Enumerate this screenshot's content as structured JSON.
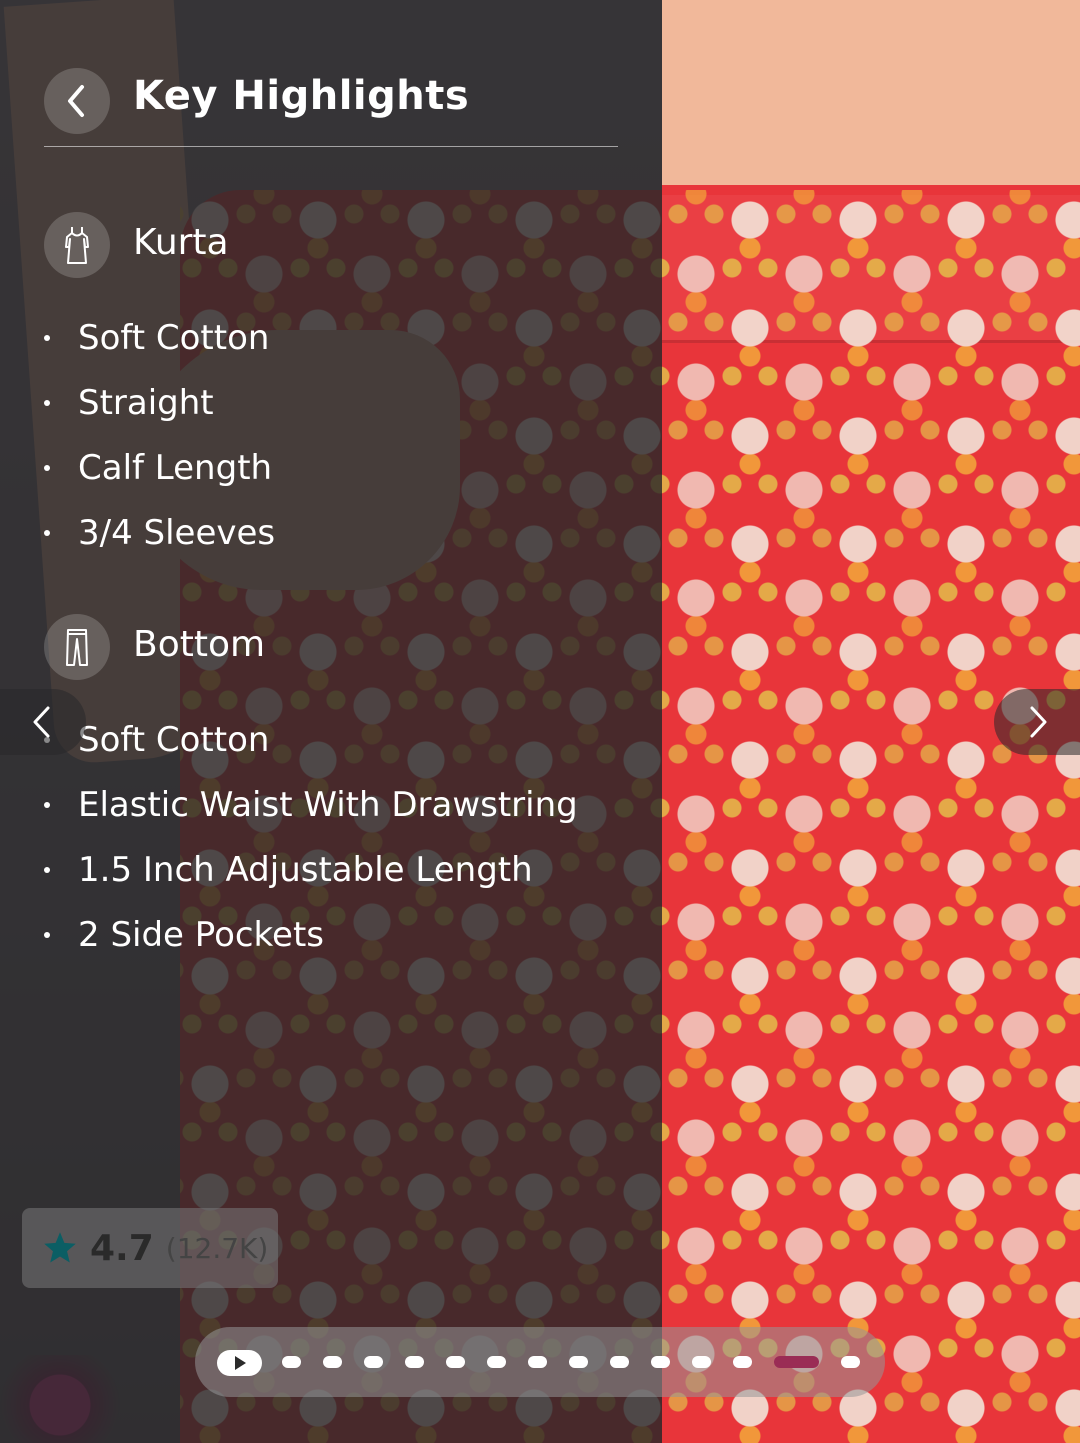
{
  "header": {
    "title": "Key Highlights"
  },
  "icons": {
    "back": "chevron-left-icon",
    "kurta": "dress-icon",
    "bottom": "trousers-icon",
    "prev": "chevron-left-icon",
    "next": "chevron-right-icon",
    "rating": "star-icon",
    "play": "play-icon"
  },
  "sections": [
    {
      "label": "Kurta",
      "items": [
        "Soft Cotton",
        "Straight",
        "Calf Length",
        "3/4 Sleeves"
      ]
    },
    {
      "label": "Bottom",
      "items": [
        "Soft Cotton",
        "Elastic Waist With Drawstring",
        "1.5 Inch Adjustable Length",
        "2 Side Pockets"
      ]
    }
  ],
  "rating": {
    "value": "4.7",
    "count": "(12.7K)"
  },
  "pager": {
    "total_dots": 14,
    "active_index": 12
  },
  "colors": {
    "overlay": "#262628",
    "rating_star": "#0b5e64",
    "pager_active": "#9a2c55",
    "text": "#ffffff"
  }
}
